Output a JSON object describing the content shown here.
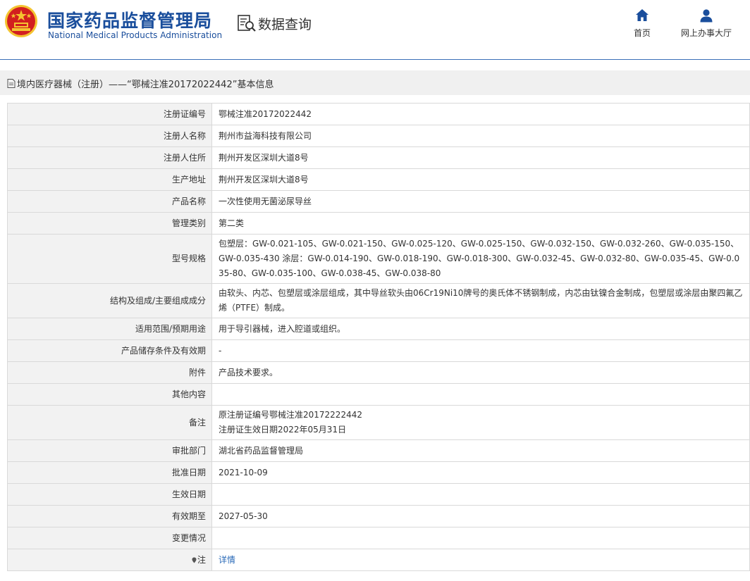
{
  "header": {
    "logo_cn": "国家药品监督管理局",
    "logo_en": "National Medical Products Administration",
    "query_label": "数据查询",
    "nav": {
      "home": "首页",
      "hall": "网上办事大厅"
    },
    "colors": {
      "brand": "#1a4e9c",
      "emblem": "#d21f1f",
      "gold": "#f4c430"
    }
  },
  "breadcrumb": "境内医疗器械（注册）——“鄂械注准20172022442”基本信息",
  "rows": {
    "reg_no": {
      "label": "注册证编号",
      "value": "鄂械注准20172022442"
    },
    "registrant": {
      "label": "注册人名称",
      "value": "荆州市益海科技有限公司"
    },
    "address": {
      "label": "注册人住所",
      "value": "荆州开发区深圳大道8号"
    },
    "production": {
      "label": "生产地址",
      "value": "荆州开发区深圳大道8号"
    },
    "product": {
      "label": "产品名称",
      "value": "一次性使用无菌泌尿导丝"
    },
    "category": {
      "label": "管理类别",
      "value": "第二类"
    },
    "model": {
      "label": "型号规格",
      "value": "包塑层：GW-0.021-105、GW-0.021-150、GW-0.025-120、GW-0.025-150、GW-0.032-150、GW-0.032-260、GW-0.035-150、GW-0.035-430 涂层：GW-0.014-190、GW-0.018-190、GW-0.018-300、GW-0.032-45、GW-0.032-80、GW-0.035-45、GW-0.035-80、GW-0.035-100、GW-0.038-45、GW-0.038-80"
    },
    "structure": {
      "label": "结构及组成/主要组成成分",
      "value": "由软头、内芯、包塑层或涂层组成，其中导丝软头由06Cr19Ni10牌号的奥氏体不锈钢制成，内芯由钛镍合金制成，包塑层或涂层由聚四氟乙烯（PTFE）制成。"
    },
    "scope": {
      "label": "适用范围/预期用途",
      "value": "用于导引器械，进入腔道或组织。"
    },
    "storage": {
      "label": "产品储存条件及有效期",
      "value": "-"
    },
    "attachment": {
      "label": "附件",
      "value": "产品技术要求。"
    },
    "other": {
      "label": "其他内容",
      "value": ""
    },
    "remark": {
      "label": "备注",
      "line1": "原注册证编号鄂械注准20172222442",
      "line2": "注册证生效日期2022年05月31日"
    },
    "dept": {
      "label": "审批部门",
      "value": "湖北省药品监督管理局"
    },
    "approve_date": {
      "label": "批准日期",
      "value": "2021-10-09"
    },
    "effective_date": {
      "label": "生效日期",
      "value": ""
    },
    "valid_until": {
      "label": "有效期至",
      "value": "2027-05-30"
    },
    "change": {
      "label": "变更情况",
      "value": ""
    },
    "note": {
      "label": "注",
      "value": "详情"
    }
  }
}
